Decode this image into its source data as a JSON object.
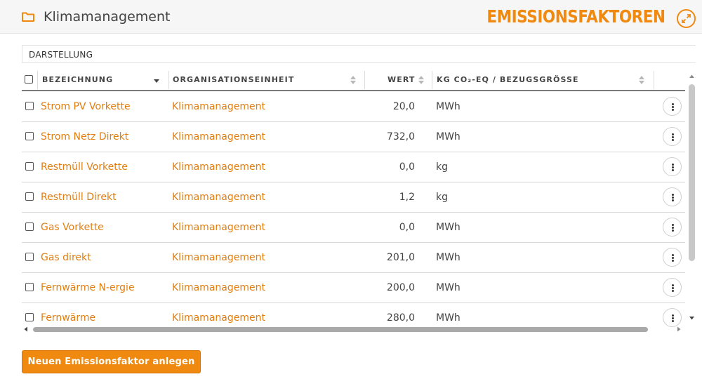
{
  "header": {
    "app_title": "Klimamanagement",
    "page_title": "EMISSIONSFAKTOREN",
    "folder_icon": "folder-icon",
    "expand_icon": "expand-icon",
    "accent_color": "#f0890f"
  },
  "toolbar": {
    "darstellung_label": "DARSTELLUNG"
  },
  "table": {
    "columns": [
      "BEZEICHNUNG",
      "ORGANISATIONSEINHEIT",
      "WERT",
      "KG CO₂-EQ / BEZUGSGRÖSSE"
    ],
    "sort_active_column": "BEZEICHNUNG",
    "sort_direction": "descending",
    "rows": [
      {
        "name": "Strom PV Vorkette",
        "org": "Klimamanagement",
        "value": "20,0",
        "unit": "MWh"
      },
      {
        "name": "Strom Netz Direkt",
        "org": "Klimamanagement",
        "value": "732,0",
        "unit": "MWh"
      },
      {
        "name": "Restmüll Vorkette",
        "org": "Klimamanagement",
        "value": "0,0",
        "unit": "kg"
      },
      {
        "name": "Restmüll Direkt",
        "org": "Klimamanagement",
        "value": "1,2",
        "unit": "kg"
      },
      {
        "name": "Gas Vorkette",
        "org": "Klimamanagement",
        "value": "0,0",
        "unit": "MWh"
      },
      {
        "name": "Gas direkt",
        "org": "Klimamanagement",
        "value": "201,0",
        "unit": "MWh"
      },
      {
        "name": "Fernwärme N-ergie",
        "org": "Klimamanagement",
        "value": "200,0",
        "unit": "MWh"
      },
      {
        "name": "Fernwärme",
        "org": "Klimamanagement",
        "value": "280,0",
        "unit": "MWh"
      }
    ]
  },
  "actions": {
    "new_button_label": "Neuen Emissionsfaktor anlegen"
  }
}
